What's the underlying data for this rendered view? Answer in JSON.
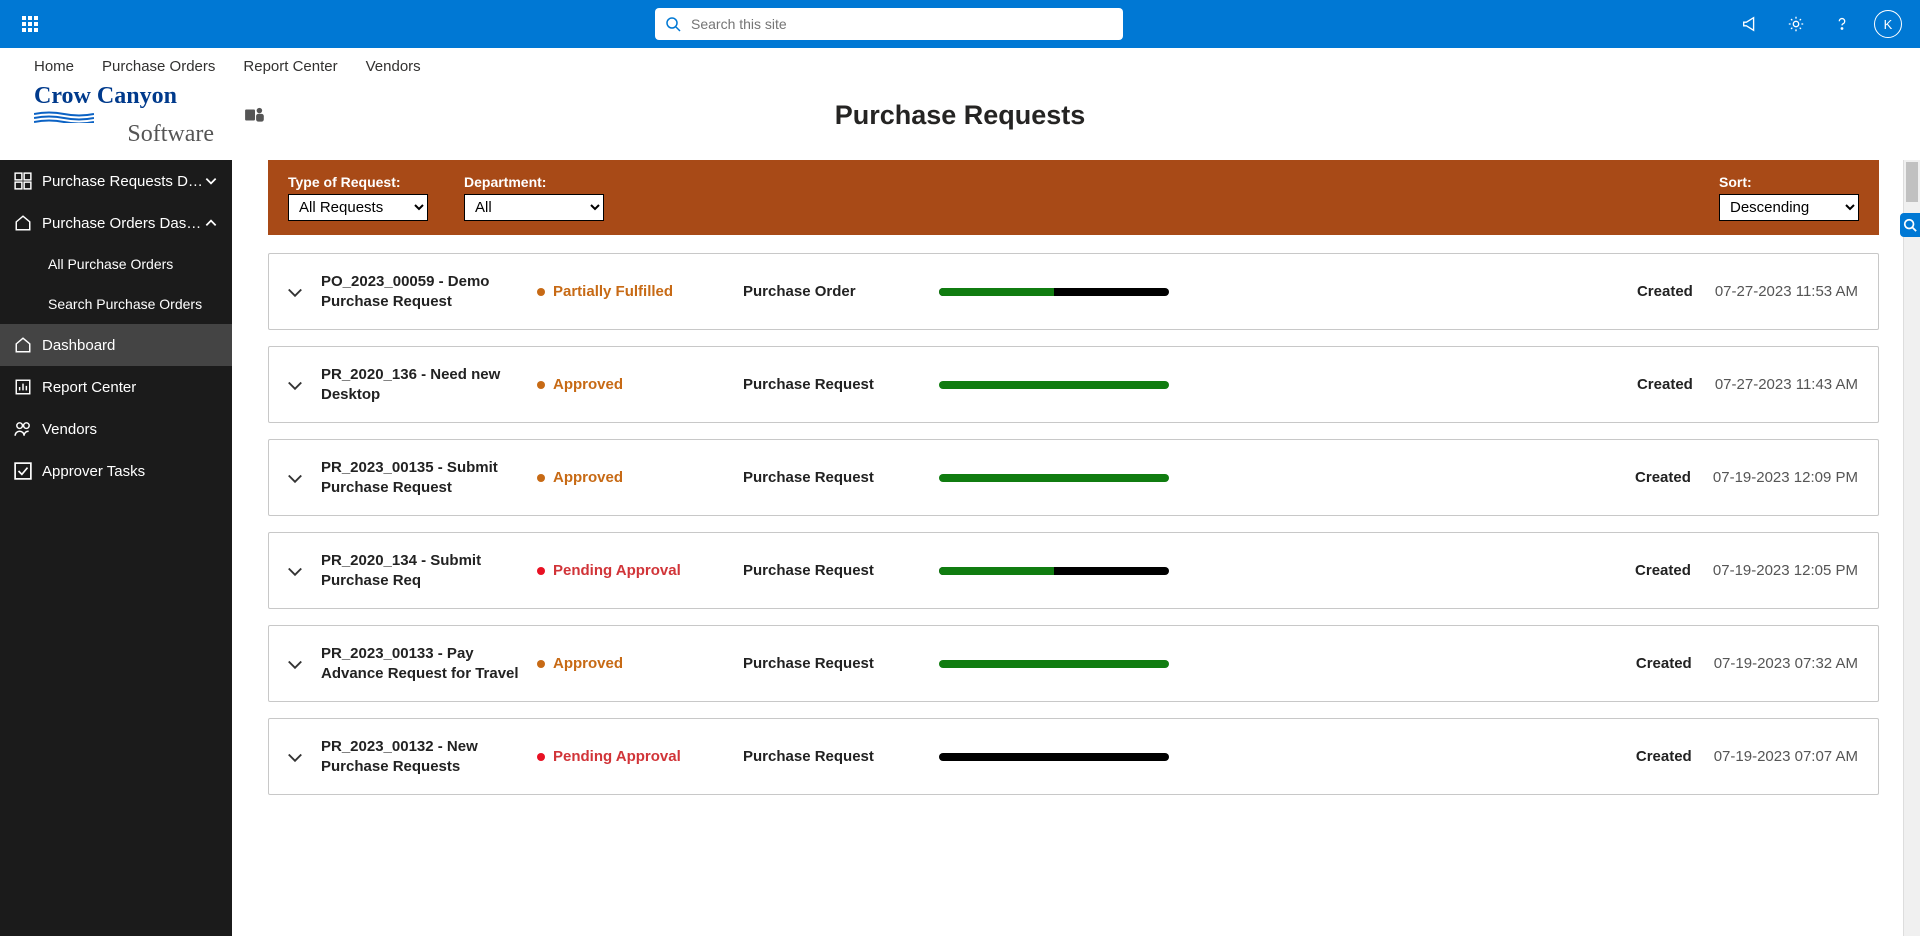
{
  "search": {
    "placeholder": "Search this site"
  },
  "avatar": "K",
  "nav": [
    "Home",
    "Purchase Orders",
    "Report Center",
    "Vendors"
  ],
  "logo": {
    "line1": "Crow Canyon",
    "line2": "Software"
  },
  "page_title": "Purchase Requests",
  "sidebar": {
    "items": [
      {
        "label": "Purchase Requests Dashboard",
        "expanded": false
      },
      {
        "label": "Purchase Orders Dashboard",
        "expanded": true,
        "children": [
          "All Purchase Orders",
          "Search Purchase Orders"
        ]
      },
      {
        "label": "Dashboard",
        "active": true
      },
      {
        "label": "Report Center"
      },
      {
        "label": "Vendors"
      },
      {
        "label": "Approver Tasks"
      }
    ]
  },
  "filters": {
    "type_label": "Type of Request:",
    "type_value": "All Requests",
    "dept_label": "Department:",
    "dept_value": "All",
    "sort_label": "Sort:",
    "sort_value": "Descending"
  },
  "created_label": "Created",
  "status_colors": {
    "Partially Fulfilled": "#c76a15",
    "Approved": "#c76a15",
    "Pending Approval": "#d13438"
  },
  "dot_colors": {
    "Partially Fulfilled": "#c76a15",
    "Approved": "#c76a15",
    "Pending Approval": "#e81123"
  },
  "requests": [
    {
      "title": "PO_2023_00059 - Demo Purchase Request",
      "status": "Partially Fulfilled",
      "type": "Purchase Order",
      "progress": 50,
      "date": "07-27-2023 11:53 AM"
    },
    {
      "title": "PR_2020_136 - Need new Desktop",
      "status": "Approved",
      "type": "Purchase Request",
      "progress": 100,
      "date": "07-27-2023 11:43 AM"
    },
    {
      "title": "PR_2023_00135 - Submit Purchase Request",
      "status": "Approved",
      "type": "Purchase Request",
      "progress": 100,
      "date": "07-19-2023 12:09 PM"
    },
    {
      "title": "PR_2020_134 - Submit Purchase Req",
      "status": "Pending Approval",
      "type": "Purchase Request",
      "progress": 50,
      "date": "07-19-2023 12:05 PM"
    },
    {
      "title": "PR_2023_00133 - Pay Advance Request for Travel",
      "status": "Approved",
      "type": "Purchase Request",
      "progress": 100,
      "date": "07-19-2023 07:32 AM"
    },
    {
      "title": "PR_2023_00132 - New Purchase Requests",
      "status": "Pending Approval",
      "type": "Purchase Request",
      "progress": 0,
      "date": "07-19-2023 07:07 AM"
    }
  ]
}
